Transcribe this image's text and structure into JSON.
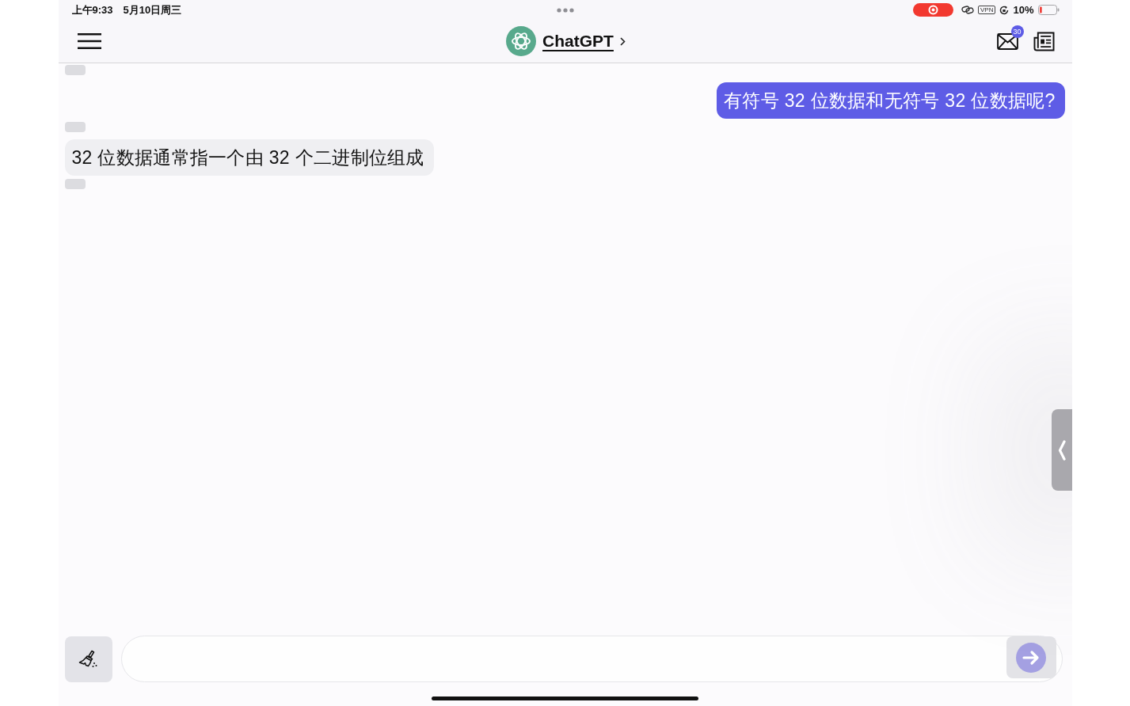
{
  "status_bar": {
    "time": "上午9:33",
    "date": "5月10日周三",
    "vpn_label": "VPN",
    "battery_percent": "10%"
  },
  "nav_bar": {
    "title": "ChatGPT",
    "mail_badge": "30"
  },
  "messages": [
    {
      "kind": "chip"
    },
    {
      "kind": "user",
      "text": "有符号 32 位数据和无符号 32 位数据呢?"
    },
    {
      "kind": "chip"
    },
    {
      "kind": "assistant",
      "text": "32 位数据通常指一个由 32 个二进制位组成"
    },
    {
      "kind": "chip"
    }
  ]
}
